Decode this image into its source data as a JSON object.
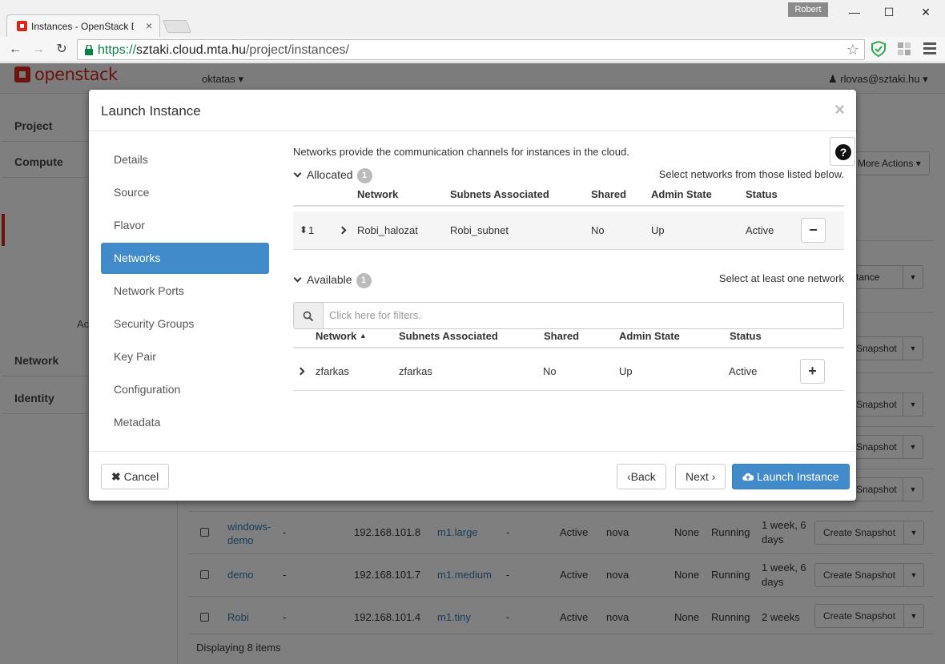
{
  "browser": {
    "tab_title": "Instances - OpenStack Da",
    "profile": "Robert",
    "url_scheme": "https://",
    "url_host": "sztaki.cloud.mta.hu",
    "url_path": "/project/instances/"
  },
  "os_header": {
    "logo": "openstack",
    "project": "oktatas ▾",
    "user": "rlovas@sztaki.hu ▾"
  },
  "sidebar": {
    "project": "Project",
    "compute": "Compute",
    "network": "Network",
    "identity": "Identity",
    "partial_label": "Ac"
  },
  "instances": {
    "more_actions": "More Actions ▾",
    "launch_partial": "tance",
    "partial_snapshot": "Snapshot",
    "rows": [
      {
        "name": "windows-demo",
        "image": "-",
        "ip": "192.168.101.8",
        "flavor": "m1.large",
        "keypair": "-",
        "status": "Active",
        "az": "nova",
        "task": "None",
        "power": "Running",
        "time": "1 week, 6 days",
        "action": "Create Snapshot"
      },
      {
        "name": "demo",
        "image": "-",
        "ip": "192.168.101.7",
        "flavor": "m1.medium",
        "keypair": "-",
        "status": "Active",
        "az": "nova",
        "task": "None",
        "power": "Running",
        "time": "1 week, 6 days",
        "action": "Create Snapshot"
      },
      {
        "name": "Robi",
        "image": "-",
        "ip": "192.168.101.4",
        "flavor": "m1.tiny",
        "keypair": "-",
        "status": "Active",
        "az": "nova",
        "task": "None",
        "power": "Running",
        "time": "2 weeks",
        "action": "Create Snapshot"
      }
    ],
    "footer": "Displaying 8 items"
  },
  "modal": {
    "title": "Launch Instance",
    "close": "×",
    "nav": [
      "Details",
      "Source",
      "Flavor",
      "Networks",
      "Network Ports",
      "Security Groups",
      "Key Pair",
      "Configuration",
      "Metadata"
    ],
    "active_nav": "Networks",
    "intro": "Networks provide the communication channels for instances in the cloud.",
    "help": "?",
    "allocated": {
      "title": "Allocated",
      "count": "1",
      "hint": "Select networks from those listed below.",
      "headers": [
        "Network",
        "Subnets Associated",
        "Shared",
        "Admin State",
        "Status"
      ],
      "rows": [
        {
          "order": "1",
          "network": "Robi_halozat",
          "subnets": "Robi_subnet",
          "shared": "No",
          "admin": "Up",
          "status": "Active",
          "action": "−"
        }
      ]
    },
    "available": {
      "title": "Available",
      "count": "1",
      "hint": "Select at least one network",
      "filter_placeholder": "Click here for filters.",
      "headers": [
        "Network",
        "Subnets Associated",
        "Shared",
        "Admin State",
        "Status"
      ],
      "rows": [
        {
          "network": "zfarkas",
          "subnets": "zfarkas",
          "shared": "No",
          "admin": "Up",
          "status": "Active",
          "action": "+"
        }
      ]
    },
    "buttons": {
      "cancel": "Cancel",
      "back": "Back",
      "next": "Next",
      "launch": "Launch Instance"
    }
  }
}
